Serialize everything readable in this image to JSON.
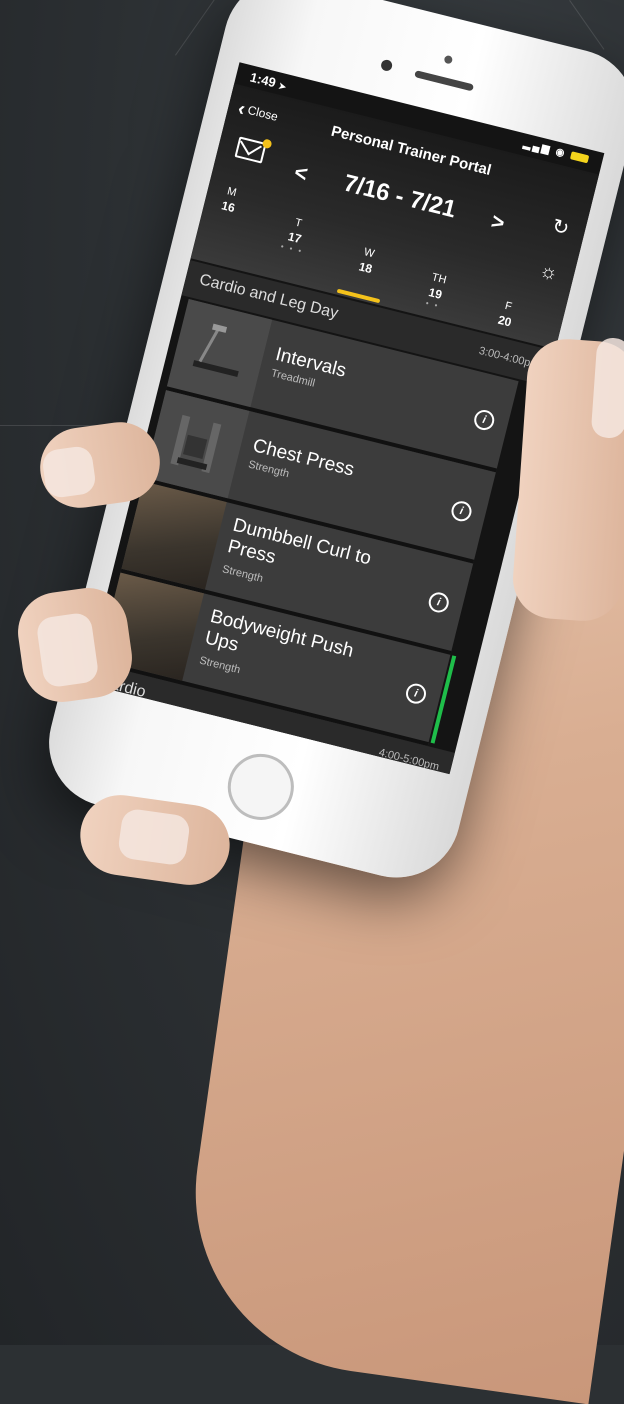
{
  "status": {
    "time": "1:49",
    "location_arrow": "➤"
  },
  "header": {
    "close_label": "Close",
    "title": "Personal Trainer Portal",
    "week_range": "7/16 - 7/21",
    "prev_arrow": "<",
    "next_arrow": ">"
  },
  "days": [
    {
      "letter": "M",
      "num": "16"
    },
    {
      "letter": "T",
      "num": "17",
      "dots": "• • •"
    },
    {
      "letter": "W",
      "num": "18"
    },
    {
      "letter": "TH",
      "num": "19",
      "dots": "• •"
    },
    {
      "letter": "F",
      "num": "20"
    }
  ],
  "sections": [
    {
      "name": "Cardio and Leg Day",
      "time": "3:00-4:00pm"
    },
    {
      "name": "Cardio",
      "time": "4:00-5:00pm"
    }
  ],
  "exercises": [
    {
      "name": "Intervals",
      "type": "Treadmill"
    },
    {
      "name": "Chest Press",
      "type": "Strength"
    },
    {
      "name": "Dumbbell Curl to Press",
      "type": "Strength"
    },
    {
      "name": "Bodyweight Push Ups",
      "type": "Strength"
    }
  ],
  "colors": {
    "accent": "#f4c21b",
    "active_bar": "#1fbe4a",
    "card": "#3c3c3c"
  },
  "icons": {
    "info": "i"
  }
}
